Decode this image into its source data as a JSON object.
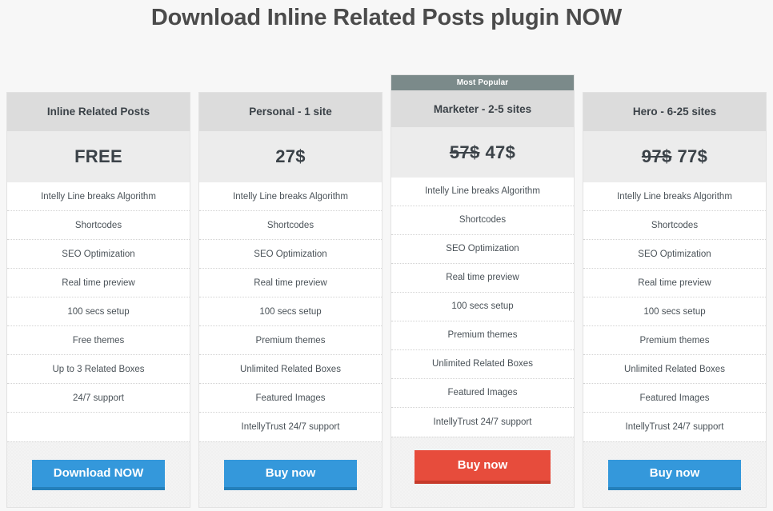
{
  "page": {
    "title": "Download Inline Related Posts plugin NOW",
    "background_color": "#f7f7f7"
  },
  "colors": {
    "ribbon": "#7b8a8a",
    "header": "#dcdcdc",
    "price_bg": "#ececec",
    "cta_blue": "#3498db",
    "cta_blue_shadow": "#2580ba",
    "cta_red": "#e74c3c",
    "cta_red_shadow": "#c63a2a",
    "text": "#3b4248"
  },
  "plans": [
    {
      "id": "free",
      "ribbon": null,
      "name": "Inline Related Posts",
      "price_old": null,
      "price": "FREE",
      "featured": false,
      "features": [
        "Intelly Line breaks Algorithm",
        "Shortcodes",
        "SEO Optimization",
        "Real time preview",
        "100 secs setup",
        "Free themes",
        "Up to 3 Related Boxes",
        "24/7 support",
        ""
      ],
      "cta_label": "Download NOW",
      "cta_style": "blue"
    },
    {
      "id": "personal",
      "ribbon": null,
      "name": "Personal - 1 site",
      "price_old": null,
      "price": "27$",
      "featured": false,
      "features": [
        "Intelly Line breaks Algorithm",
        "Shortcodes",
        "SEO Optimization",
        "Real time preview",
        "100 secs setup",
        "Premium themes",
        "Unlimited Related Boxes",
        "Featured Images",
        "IntellyTrust 24/7 support"
      ],
      "cta_label": "Buy now",
      "cta_style": "blue"
    },
    {
      "id": "marketer",
      "ribbon": "Most Popular",
      "name": "Marketer - 2-5 sites",
      "price_old": "57$",
      "price": "47$",
      "featured": true,
      "features": [
        "Intelly Line breaks Algorithm",
        "Shortcodes",
        "SEO Optimization",
        "Real time preview",
        "100 secs setup",
        "Premium themes",
        "Unlimited Related Boxes",
        "Featured Images",
        "IntellyTrust 24/7 support"
      ],
      "cta_label": "Buy now",
      "cta_style": "red"
    },
    {
      "id": "hero",
      "ribbon": null,
      "name": "Hero - 6-25 sites",
      "price_old": "97$",
      "price": "77$",
      "featured": false,
      "features": [
        "Intelly Line breaks Algorithm",
        "Shortcodes",
        "SEO Optimization",
        "Real time preview",
        "100 secs setup",
        "Premium themes",
        "Unlimited Related Boxes",
        "Featured Images",
        "IntellyTrust 24/7 support"
      ],
      "cta_label": "Buy now",
      "cta_style": "blue"
    }
  ]
}
